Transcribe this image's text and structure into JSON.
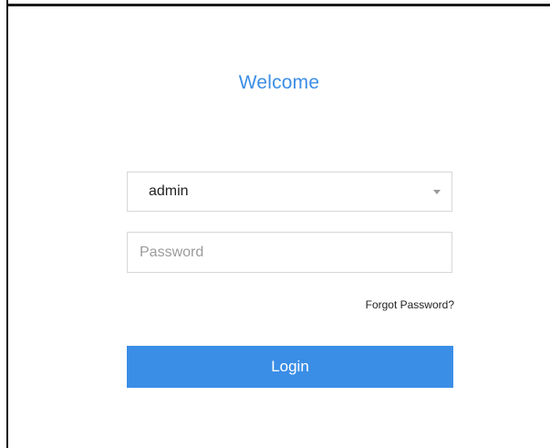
{
  "dialog": {
    "title": "Welcome",
    "title_color": "#3b8ee6"
  },
  "username": {
    "selected_value": "admin",
    "icon": "chevron-down-icon"
  },
  "password": {
    "placeholder": "Password",
    "value": ""
  },
  "links": {
    "forgot_password": "Forgot Password?"
  },
  "actions": {
    "login_label": "Login",
    "login_color": "#3a8ee6"
  }
}
